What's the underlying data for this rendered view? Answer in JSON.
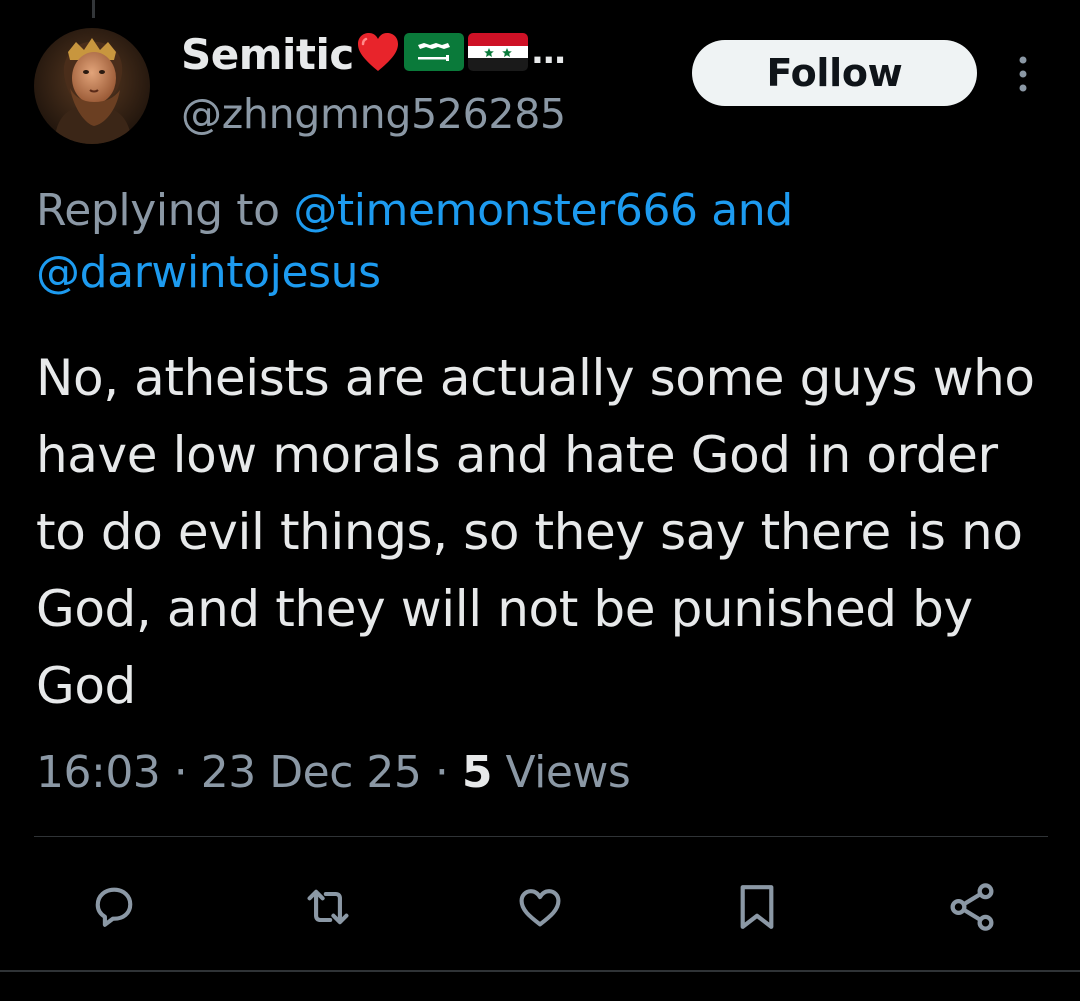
{
  "tweet": {
    "author": {
      "display_name": "Semitic",
      "display_name_suffix": "…",
      "handle": "@zhngmng526285",
      "avatar_icon": "avatar-bearded-man-portrait",
      "emoji": [
        "red-heart",
        "saudi-arabia-flag",
        "syria-flag"
      ]
    },
    "follow_label": "Follow",
    "more_icon": "more-vertical-icon",
    "reply_prefix": "Replying to ",
    "reply_users": [
      "@timemonster666",
      "@darwintojesus"
    ],
    "reply_joiner": " and ",
    "text": "No, atheists are actually some guys who have low morals and hate God in order to do evil things, so they say there is no God, and they will not be punished by God",
    "time": "16:03",
    "sep1": " · ",
    "date": "23 Dec 25",
    "sep2": " · ",
    "views_count": "5",
    "views_label": " Views"
  },
  "actions": [
    {
      "icon": "reply-icon"
    },
    {
      "icon": "retweet-icon"
    },
    {
      "icon": "like-icon"
    },
    {
      "icon": "bookmark-icon"
    },
    {
      "icon": "share-icon"
    }
  ],
  "colors": {
    "background": "#000000",
    "text_primary": "#e7e9ea",
    "text_secondary": "#8b98a5",
    "link": "#1d9bf0",
    "follow_bg": "#eff3f4",
    "follow_text": "#0f1419",
    "divider": "#2f3336"
  }
}
